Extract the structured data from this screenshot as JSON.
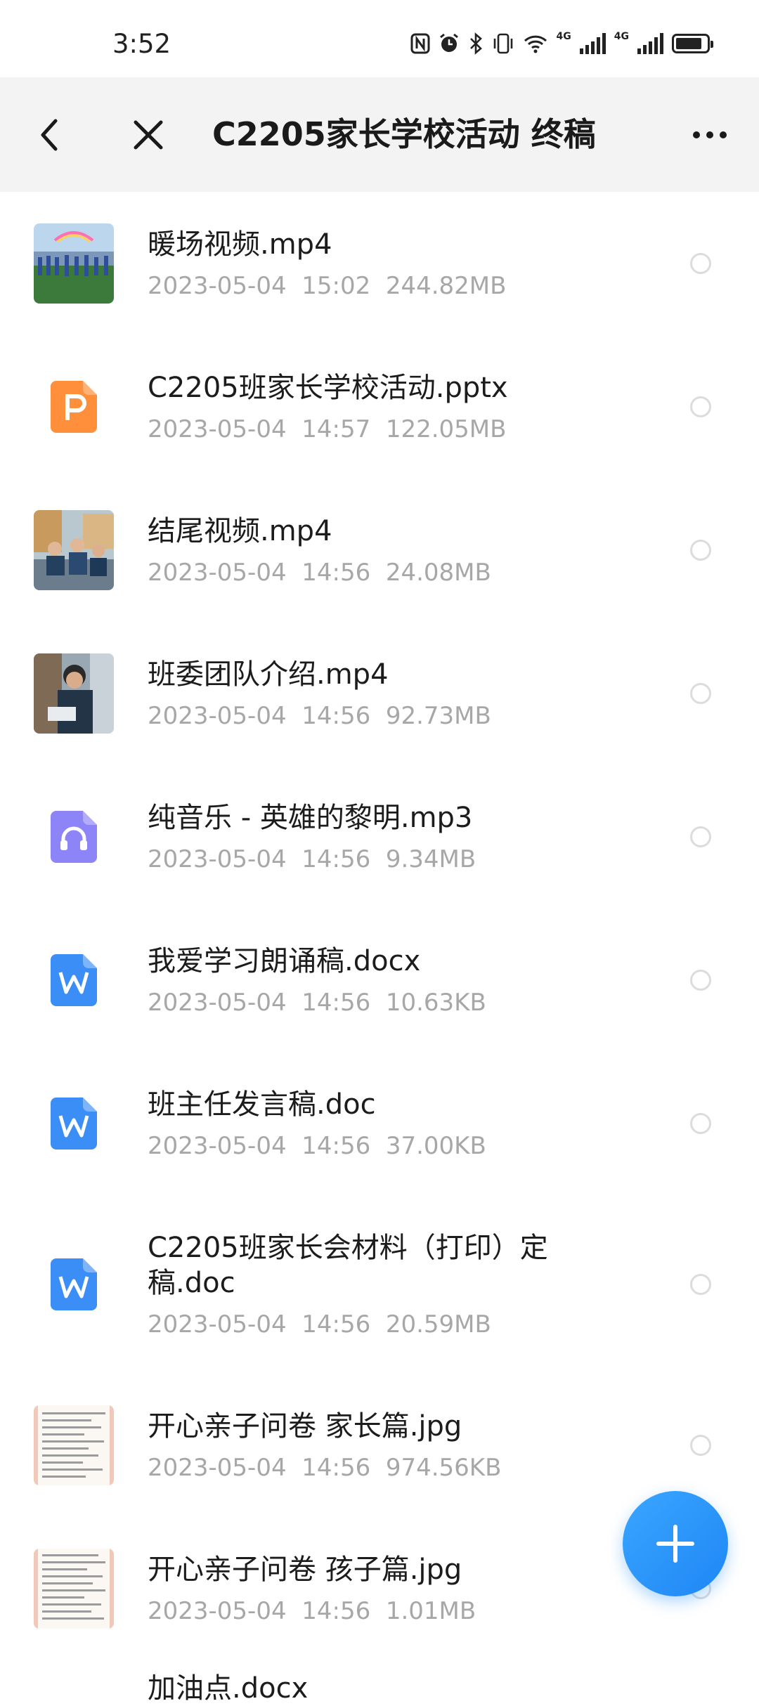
{
  "status_bar": {
    "time": "3:52",
    "net_label_1": "4G",
    "net_label_2": "4G",
    "icons": [
      "nfc-icon",
      "alarm-icon",
      "bluetooth-icon",
      "vibrate-icon",
      "wifi-icon",
      "signal-icon",
      "signal-icon",
      "battery-icon"
    ]
  },
  "header": {
    "title": "C2205家长学校活动 终稿",
    "back_icon": "chevron-left-icon",
    "close_icon": "close-icon",
    "more_icon": "more-icon"
  },
  "files": [
    {
      "name": "暖场视频.mp4",
      "date": "2023-05-04",
      "time": "15:02",
      "size": "244.82MB",
      "kind": "video-thumb"
    },
    {
      "name": "C2205班家长学校活动.pptx",
      "date": "2023-05-04",
      "time": "14:57",
      "size": "122.05MB",
      "kind": "ppt-icon"
    },
    {
      "name": "结尾视频.mp4",
      "date": "2023-05-04",
      "time": "14:56",
      "size": "24.08MB",
      "kind": "video-thumb"
    },
    {
      "name": "班委团队介绍.mp4",
      "date": "2023-05-04",
      "time": "14:56",
      "size": "92.73MB",
      "kind": "video-thumb"
    },
    {
      "name": "纯音乐 - 英雄的黎明.mp3",
      "date": "2023-05-04",
      "time": "14:56",
      "size": "9.34MB",
      "kind": "audio-icon"
    },
    {
      "name": "我爱学习朗诵稿.docx",
      "date": "2023-05-04",
      "time": "14:56",
      "size": "10.63KB",
      "kind": "word-icon"
    },
    {
      "name": "班主任发言稿.doc",
      "date": "2023-05-04",
      "time": "14:56",
      "size": "37.00KB",
      "kind": "word-icon"
    },
    {
      "name": "C2205班家长会材料（打印）定稿.doc",
      "date": "2023-05-04",
      "time": "14:56",
      "size": "20.59MB",
      "kind": "word-icon"
    },
    {
      "name": "开心亲子问卷 家长篇.jpg",
      "date": "2023-05-04",
      "time": "14:56",
      "size": "974.56KB",
      "kind": "image-thumb"
    },
    {
      "name": "开心亲子问卷 孩子篇.jpg",
      "date": "2023-05-04",
      "time": "14:56",
      "size": "1.01MB",
      "kind": "image-thumb"
    }
  ],
  "partial_row": "加油点.docx",
  "colors": {
    "accent": "#2f97fb",
    "ppt": "#ff8f3a",
    "audio": "#8d84f7",
    "word": "#3c8ef7",
    "meta_text": "#a7a7a7",
    "header_bg": "#f3f3f3"
  },
  "fab": {
    "icon": "plus-icon"
  }
}
